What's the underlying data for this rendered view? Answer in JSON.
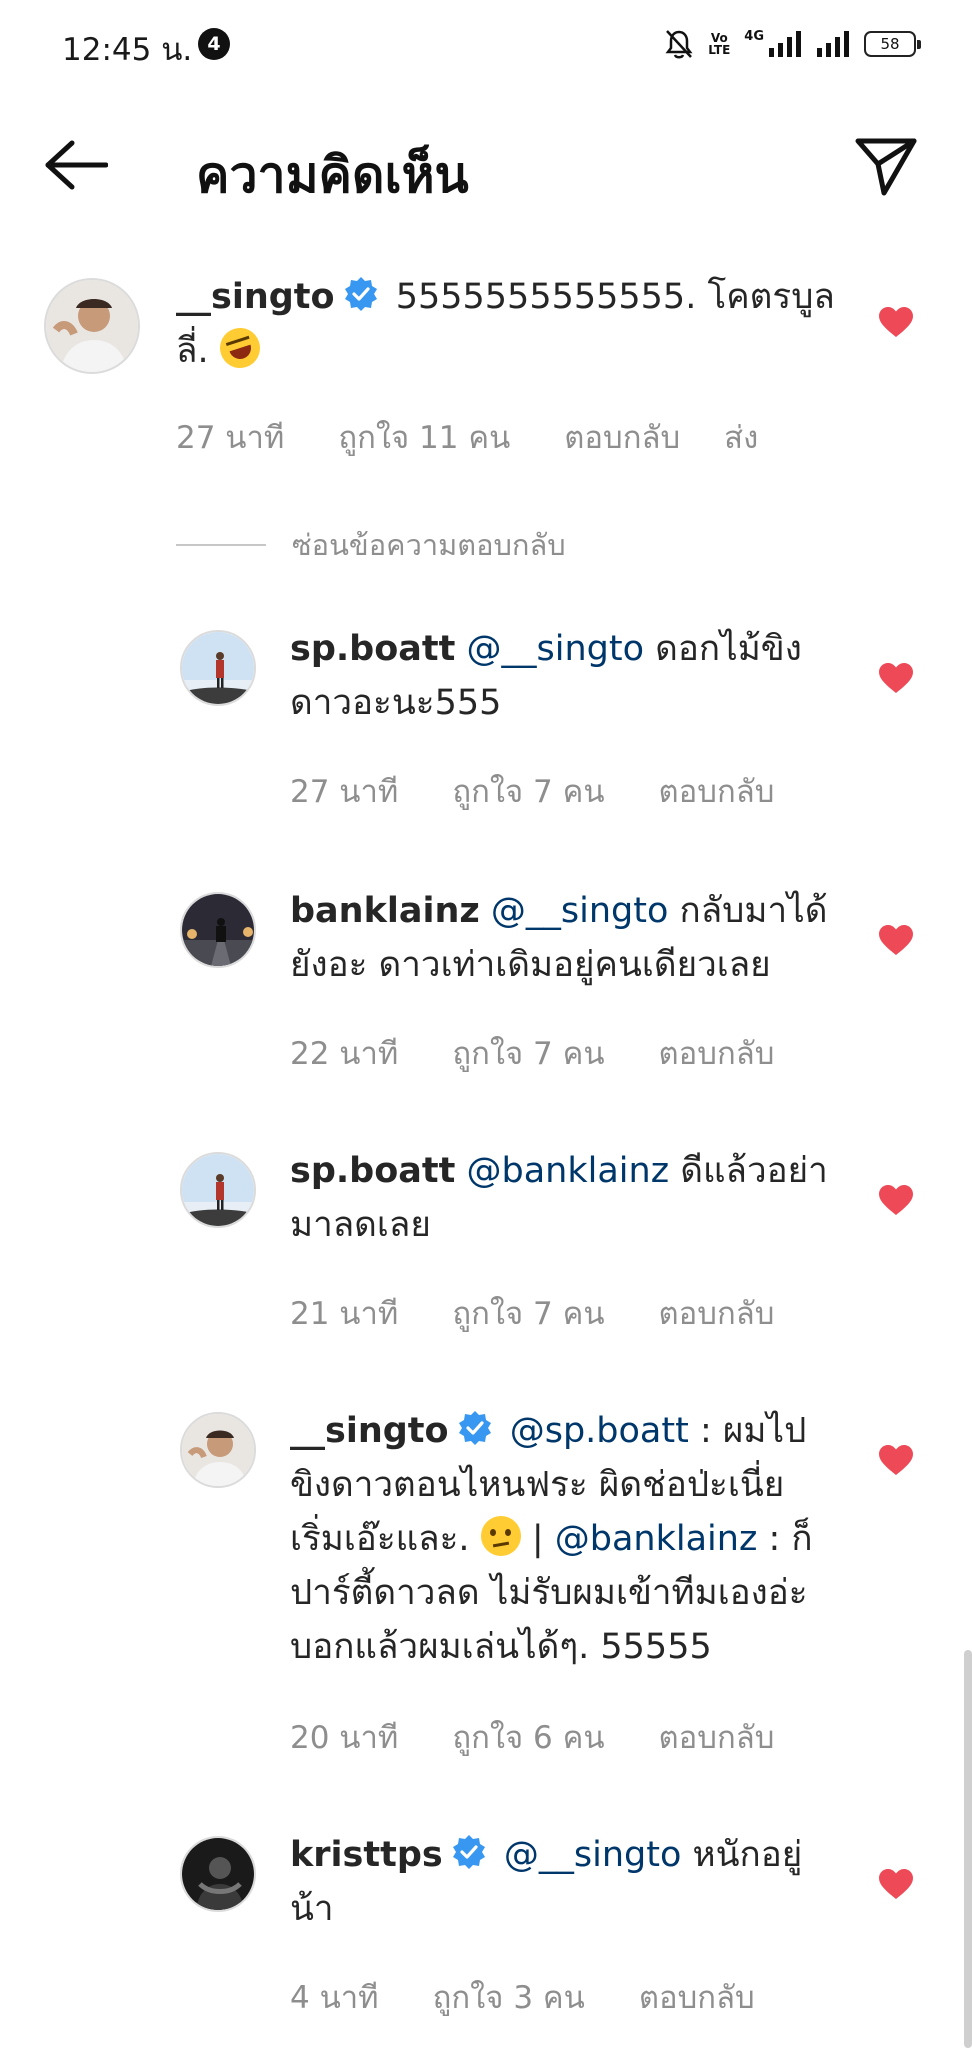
{
  "status_bar": {
    "time": "12:45 น.",
    "notification_count": "4",
    "volte_top": "Vo",
    "volte_bottom": "LTE",
    "network": "4G",
    "battery": "58"
  },
  "header": {
    "title": "ความคิดเห็น"
  },
  "main_comment": {
    "username": "__singto",
    "verified": true,
    "text_line1": "5555555555555. โคตรบูล",
    "text_line2": "ลี่.",
    "emoji": "rolling-on-floor-laughing",
    "time": "27 นาที",
    "likes": "ถูกใจ 11 คน",
    "reply": "ตอบกลับ",
    "send": "ส่ง"
  },
  "hide_replies_label": "ซ่อนข้อความตอบกลับ",
  "replies": [
    {
      "username": "sp.boatt",
      "mention": "@__singto",
      "text_line1": "ดอกไม้ขิง",
      "text_line2": "ดาวอะนะ555",
      "time": "27 นาที",
      "likes": "ถูกใจ 7 คน",
      "reply": "ตอบกลับ"
    },
    {
      "username": "banklainz",
      "mention": "@__singto",
      "text_line1": "กลับมาได้",
      "text_line2": "ยังอะ ดาวเท่าเดิมอยู่คนเดียวเลย",
      "time": "22 นาที",
      "likes": "ถูกใจ 7 คน",
      "reply": "ตอบกลับ"
    },
    {
      "username": "sp.boatt",
      "mention": "@banklainz",
      "text_line1": "ดีแล้วอย่า",
      "text_line2": "มาลดเลย",
      "time": "21 นาที",
      "likes": "ถูกใจ 7 คน",
      "reply": "ตอบกลับ"
    },
    {
      "username": "__singto",
      "verified": true,
      "mention": "@sp.boatt",
      "text_line1": ": ผมไป",
      "text_line2": "ขิงดาวตอนไหนฟระ ผิดช่อป่ะเนี่ย",
      "text_line3": "เริ่มเอ๊ะและ.",
      "emoji": "face-with-raised-eyebrow",
      "separator": "|",
      "mention2": "@banklainz",
      "text_line3b": ": ก็",
      "text_line4": "ปาร์ตี้ดาวลด ไม่รับผมเข้าทีมเองอ่ะ",
      "text_line5": "บอกแล้วผมเล่นได้ๆ. 55555",
      "time": "20 นาที",
      "likes": "ถูกใจ 6 คน",
      "reply": "ตอบกลับ"
    },
    {
      "username": "kristtps",
      "verified": true,
      "mention": "@__singto",
      "text_line1": "หนักอยู่",
      "text_line2": "น้า",
      "time": "4 นาที",
      "likes": "ถูกใจ 3 คน",
      "reply": "ตอบกลับ"
    }
  ],
  "colors": {
    "heart": "#ed4956",
    "mention": "#00376b",
    "verified": "#3897f0",
    "meta": "#8e8e8e"
  }
}
